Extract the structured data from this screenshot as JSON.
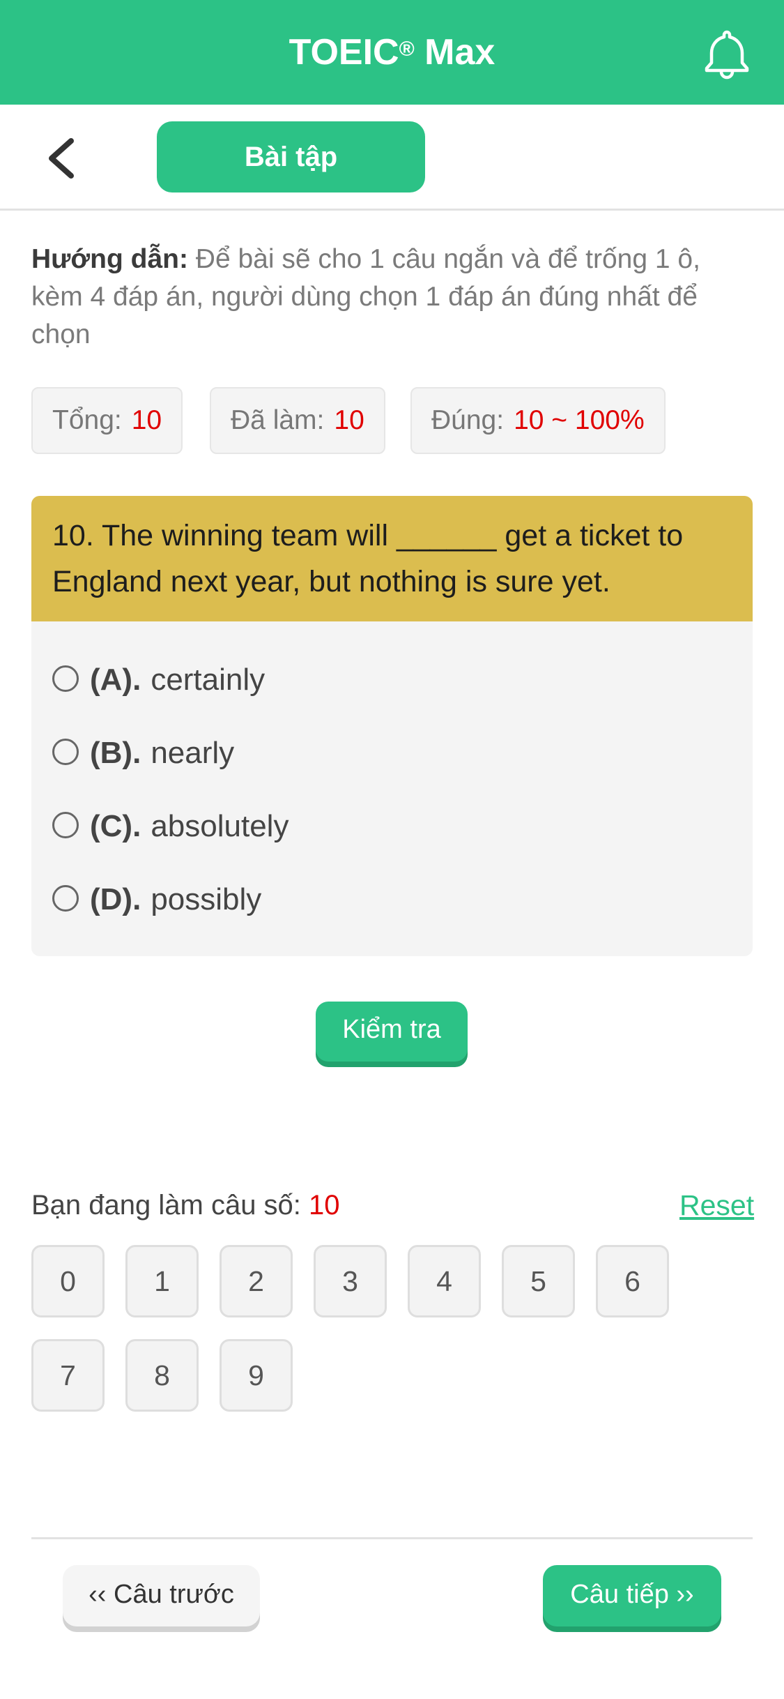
{
  "header": {
    "title": "TOEIC",
    "title_mark": "®",
    "title_suffix": " Max",
    "bell_icon": "bell-icon"
  },
  "subbar": {
    "back_icon": "chevron-left-icon",
    "tab_label": "Bài tập"
  },
  "guide": {
    "label": "Hướng dẫn:",
    "text": " Để bài sẽ cho 1 câu ngắn và để trống 1 ô, kèm 4 đáp án, người dùng chọn 1 đáp án đúng nhất để chọn"
  },
  "stats": {
    "total_label": "Tổng:",
    "total_value": "10",
    "done_label": "Đã làm:",
    "done_value": "10",
    "correct_label": "Đúng:",
    "correct_value": "10 ~ 100%"
  },
  "question": {
    "text": "10. The winning team will ______ get a ticket to England next year, but nothing is sure yet.",
    "options": [
      {
        "letter": "(A).",
        "text": "certainly"
      },
      {
        "letter": "(B).",
        "text": "nearly"
      },
      {
        "letter": "(C).",
        "text": "absolutely"
      },
      {
        "letter": "(D).",
        "text": "possibly"
      }
    ]
  },
  "check_button": "Kiểm tra",
  "progress": {
    "label": "Bạn đang làm câu số: ",
    "current": "10",
    "reset": "Reset"
  },
  "numbers": [
    "0",
    "1",
    "2",
    "3",
    "4",
    "5",
    "6",
    "7",
    "8",
    "9"
  ],
  "nav": {
    "prev": "‹‹ Câu trước",
    "next": "Câu tiếp ››"
  },
  "colors": {
    "accent": "#2cc286",
    "question_header": "#dbbd4f",
    "highlight": "#e00000"
  }
}
